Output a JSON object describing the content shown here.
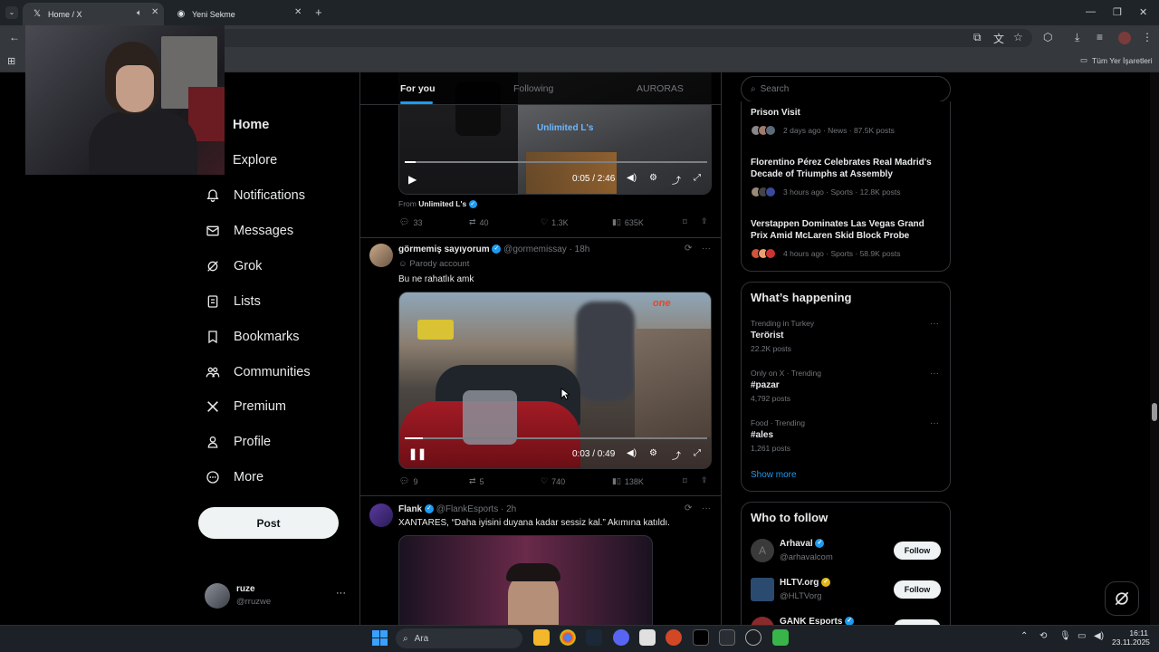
{
  "browser": {
    "tabs": [
      {
        "title": "Home / X",
        "active": true
      },
      {
        "title": "Yeni Sekme",
        "active": false
      }
    ],
    "bookmarks_folder": "Tüm Yer İşaretleri"
  },
  "nav": {
    "items": [
      {
        "label": "Home",
        "icon": "home-icon"
      },
      {
        "label": "Explore",
        "icon": "search-icon"
      },
      {
        "label": "Notifications",
        "icon": "bell-icon"
      },
      {
        "label": "Messages",
        "icon": "envelope-icon"
      },
      {
        "label": "Grok",
        "icon": "grok-icon"
      },
      {
        "label": "Lists",
        "icon": "list-icon"
      },
      {
        "label": "Bookmarks",
        "icon": "bookmark-icon"
      },
      {
        "label": "Communities",
        "icon": "people-icon"
      },
      {
        "label": "Premium",
        "icon": "x-logo-icon"
      },
      {
        "label": "Profile",
        "icon": "person-icon"
      },
      {
        "label": "More",
        "icon": "more-circle-icon"
      }
    ],
    "post_label": "Post",
    "account": {
      "name": "ruze",
      "handle": "@rruzwe",
      "more": "···"
    }
  },
  "timeline": {
    "tabs": [
      "For you",
      "Following",
      "AURORAS"
    ],
    "post1": {
      "video_time": "0:05 / 2:46",
      "watermark": "Unlimited L's",
      "from_label": "From",
      "from_name": "Unlimited L's",
      "replies": "33",
      "reposts": "40",
      "likes": "1.3K",
      "views": "635K"
    },
    "post2": {
      "name": "görmemiş sayıyorum",
      "handle": "@gormemissay",
      "time": "· 18h",
      "label": "Parody account",
      "text": "Bu ne rahatlık amk",
      "video_time": "0:03 / 0:49",
      "replies": "9",
      "reposts": "5",
      "likes": "740",
      "views": "138K"
    },
    "post3": {
      "name": "Flank",
      "handle": "@FlankEsports",
      "time": "· 2h",
      "text": "XANTARES, “Daha iyisini duyana kadar sessiz kal.” Akımına katıldı."
    }
  },
  "right": {
    "search_placeholder": "Search",
    "news": [
      {
        "title": "Prison Visit",
        "meta": "2 days ago · News · 87.5K posts"
      },
      {
        "title": "Florentino Pérez Celebrates Real Madrid's Decade of Triumphs at Assembly",
        "meta": "3 hours ago · Sports · 12.8K posts"
      },
      {
        "title": "Verstappen Dominates Las Vegas Grand Prix Amid McLaren Skid Block Probe",
        "meta": "4 hours ago · Sports · 58.9K posts"
      }
    ],
    "whats_happening": {
      "title": "What’s happening",
      "trends": [
        {
          "context": "Trending in Turkey",
          "name": "Terörist",
          "posts": "22.2K posts"
        },
        {
          "context": "Only on X · Trending",
          "name": "#pazar",
          "posts": "4,792 posts"
        },
        {
          "context": "Food · Trending",
          "name": "#ales",
          "posts": "1,261 posts"
        }
      ],
      "show_more": "Show more"
    },
    "who_to_follow": {
      "title": "Who to follow",
      "accounts": [
        {
          "name": "Arhaval",
          "handle": "@arhavalcom",
          "button": "Follow",
          "badge": "#1d9bf0"
        },
        {
          "name": "HLTV.org",
          "handle": "@HLTVorg",
          "button": "Follow",
          "badge": "#e2b719"
        },
        {
          "name": "GANK Esports",
          "handle": "",
          "button": "Follow",
          "badge": "#1d9bf0"
        }
      ]
    }
  },
  "taskbar": {
    "search_label": "Ara",
    "time": "16:11",
    "date": "23.11.2025"
  },
  "colors": {
    "accent": "#1d9bf0",
    "background": "#000000",
    "border": "#2f3336"
  }
}
